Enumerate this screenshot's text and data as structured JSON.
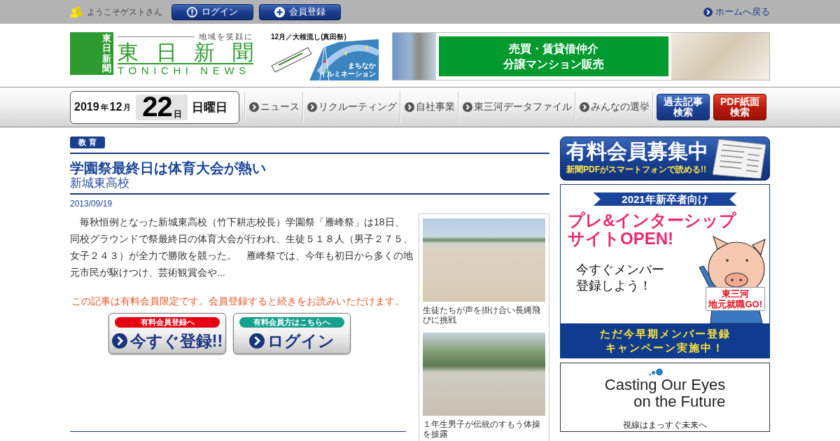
{
  "top_bar": {
    "greeting": "ようこそゲストさん",
    "buttons": [
      {
        "kind": "login",
        "label": "ログイン"
      },
      {
        "kind": "register",
        "label": "会員登録"
      }
    ],
    "home_link": "ホームへ戻る"
  },
  "header": {
    "logo": {
      "vertical_name": "東日新聞",
      "tagline": "地域を笑顔に",
      "name": "東日新聞",
      "name_en": "TONICHI NEWS"
    },
    "event_banner": {
      "title": "12月／大根流し",
      "title_note": "(真田祭)",
      "caption_lines": [
        "まちなか",
        "イルミネーション"
      ]
    },
    "ad_banner": {
      "lines": [
        "売買・賃貸借仲介",
        "分譲マンション販売"
      ]
    }
  },
  "nav": {
    "date": {
      "year": "2019",
      "year_unit": "年",
      "month": "12",
      "month_unit": "月",
      "day": "22",
      "day_unit": "日",
      "weekday": "日曜日"
    },
    "items": [
      "ニュース",
      "リクルーティング",
      "自社事業",
      "東三河データファイル",
      "みんなの選挙"
    ],
    "buttons": [
      {
        "kind": "archive",
        "label": "過去記事検索"
      },
      {
        "kind": "pdf",
        "label": "PDF紙面検索"
      }
    ]
  },
  "article": {
    "category": "教 育",
    "title": "学園祭最終日は体育大会が熱い",
    "subtitle": "新城東高校",
    "date": "2013/09/19",
    "body": "　毎秋恒例となった新城東高校（竹下耕志校長）学園祭「雁峰祭」は18日、同校グラウンドで祭最終日の体育大会が行われ、生徒５１８人（男子２７５、女子２４３）が全力で勝敗を競った。　雁峰祭では、今年も初日から多くの地元市民が駆けつけ、芸術観賞会や...",
    "paywall_notice": "この記事は有料会員限定です。会員登録すると続きをお読みいただけます。",
    "cta_buttons": [
      {
        "kind": "register",
        "tag": "有料会員登録へ",
        "label": "今すぐ登録!!"
      },
      {
        "kind": "login",
        "tag": "有料会員方はこちらへ",
        "label": "ログイン"
      }
    ],
    "photos": [
      {
        "caption": "生徒たちが声を掛け合い長縄飛びに挑戦"
      },
      {
        "caption": "１年生男子が伝統のすもう体操を披露"
      }
    ]
  },
  "sidebar": {
    "banners": [
      {
        "kind": "membership",
        "title": "有料会員募集中",
        "subtitle": "新聞PDFがスマートフォンで読める!!"
      },
      {
        "kind": "recruit",
        "ribbon": "2021年新卒者向け",
        "headline_lines": [
          "プレ&インターシップ",
          "サイトOPEN!"
        ],
        "callout": "今すぐメンバー登録しよう！",
        "sign_lines": [
          "東三河",
          "地元就職GO!"
        ],
        "footer": "ただ今早期メンバー登録キャンペーン実施中！"
      },
      {
        "kind": "slogan",
        "title": "Casting Our Eyes\non the Future",
        "caption": "視線はまっすぐ未来へ"
      }
    ]
  }
}
